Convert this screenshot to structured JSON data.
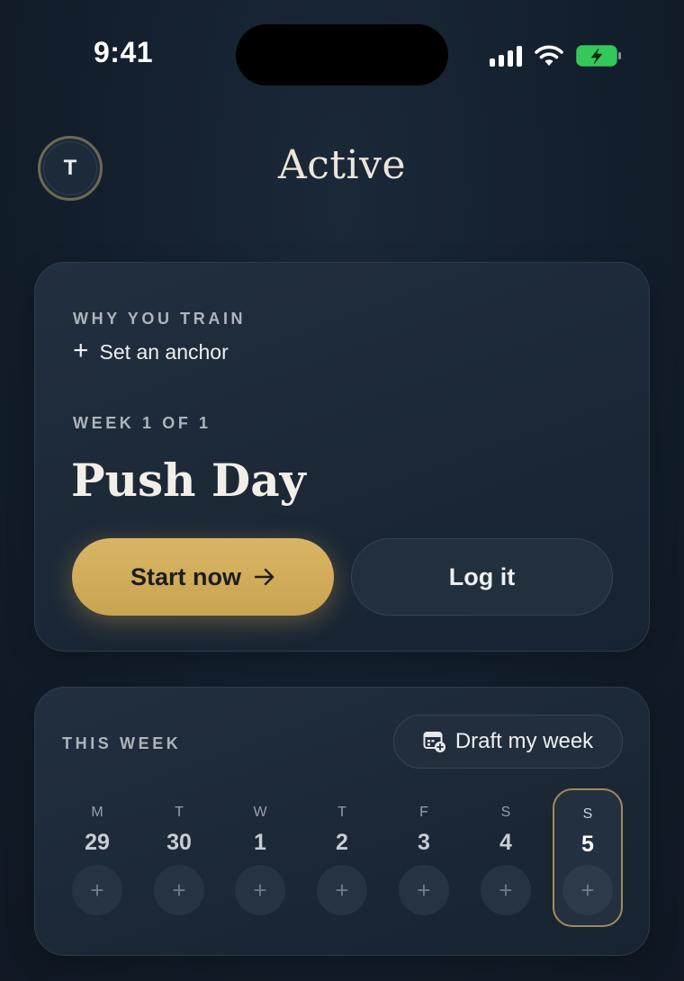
{
  "status_bar": {
    "time": "9:41",
    "icons": [
      "signal-icon",
      "wifi-icon",
      "battery-charging-icon"
    ]
  },
  "header": {
    "avatar_initial": "T",
    "title": "Active"
  },
  "program_card": {
    "why_label": "WHY YOU TRAIN",
    "anchor_action": "Set an anchor",
    "week_label": "WEEK 1 OF 1",
    "workout_title": "Push Day",
    "start_button": "Start now",
    "log_button": "Log it"
  },
  "week_card": {
    "label": "THIS WEEK",
    "draft_button": "Draft my week",
    "add_glyph": "+",
    "days": [
      {
        "letter": "M",
        "date": "29",
        "selected": false
      },
      {
        "letter": "T",
        "date": "30",
        "selected": false
      },
      {
        "letter": "W",
        "date": "1",
        "selected": false
      },
      {
        "letter": "T",
        "date": "2",
        "selected": false
      },
      {
        "letter": "F",
        "date": "3",
        "selected": false
      },
      {
        "letter": "S",
        "date": "4",
        "selected": false
      },
      {
        "letter": "S",
        "date": "5",
        "selected": true
      }
    ]
  },
  "colors": {
    "background": "#14202e",
    "card": "#1f2b3a",
    "accent_gold": "#d2ae5c",
    "selected_border": "#a28a57",
    "battery_green": "#34c759"
  }
}
